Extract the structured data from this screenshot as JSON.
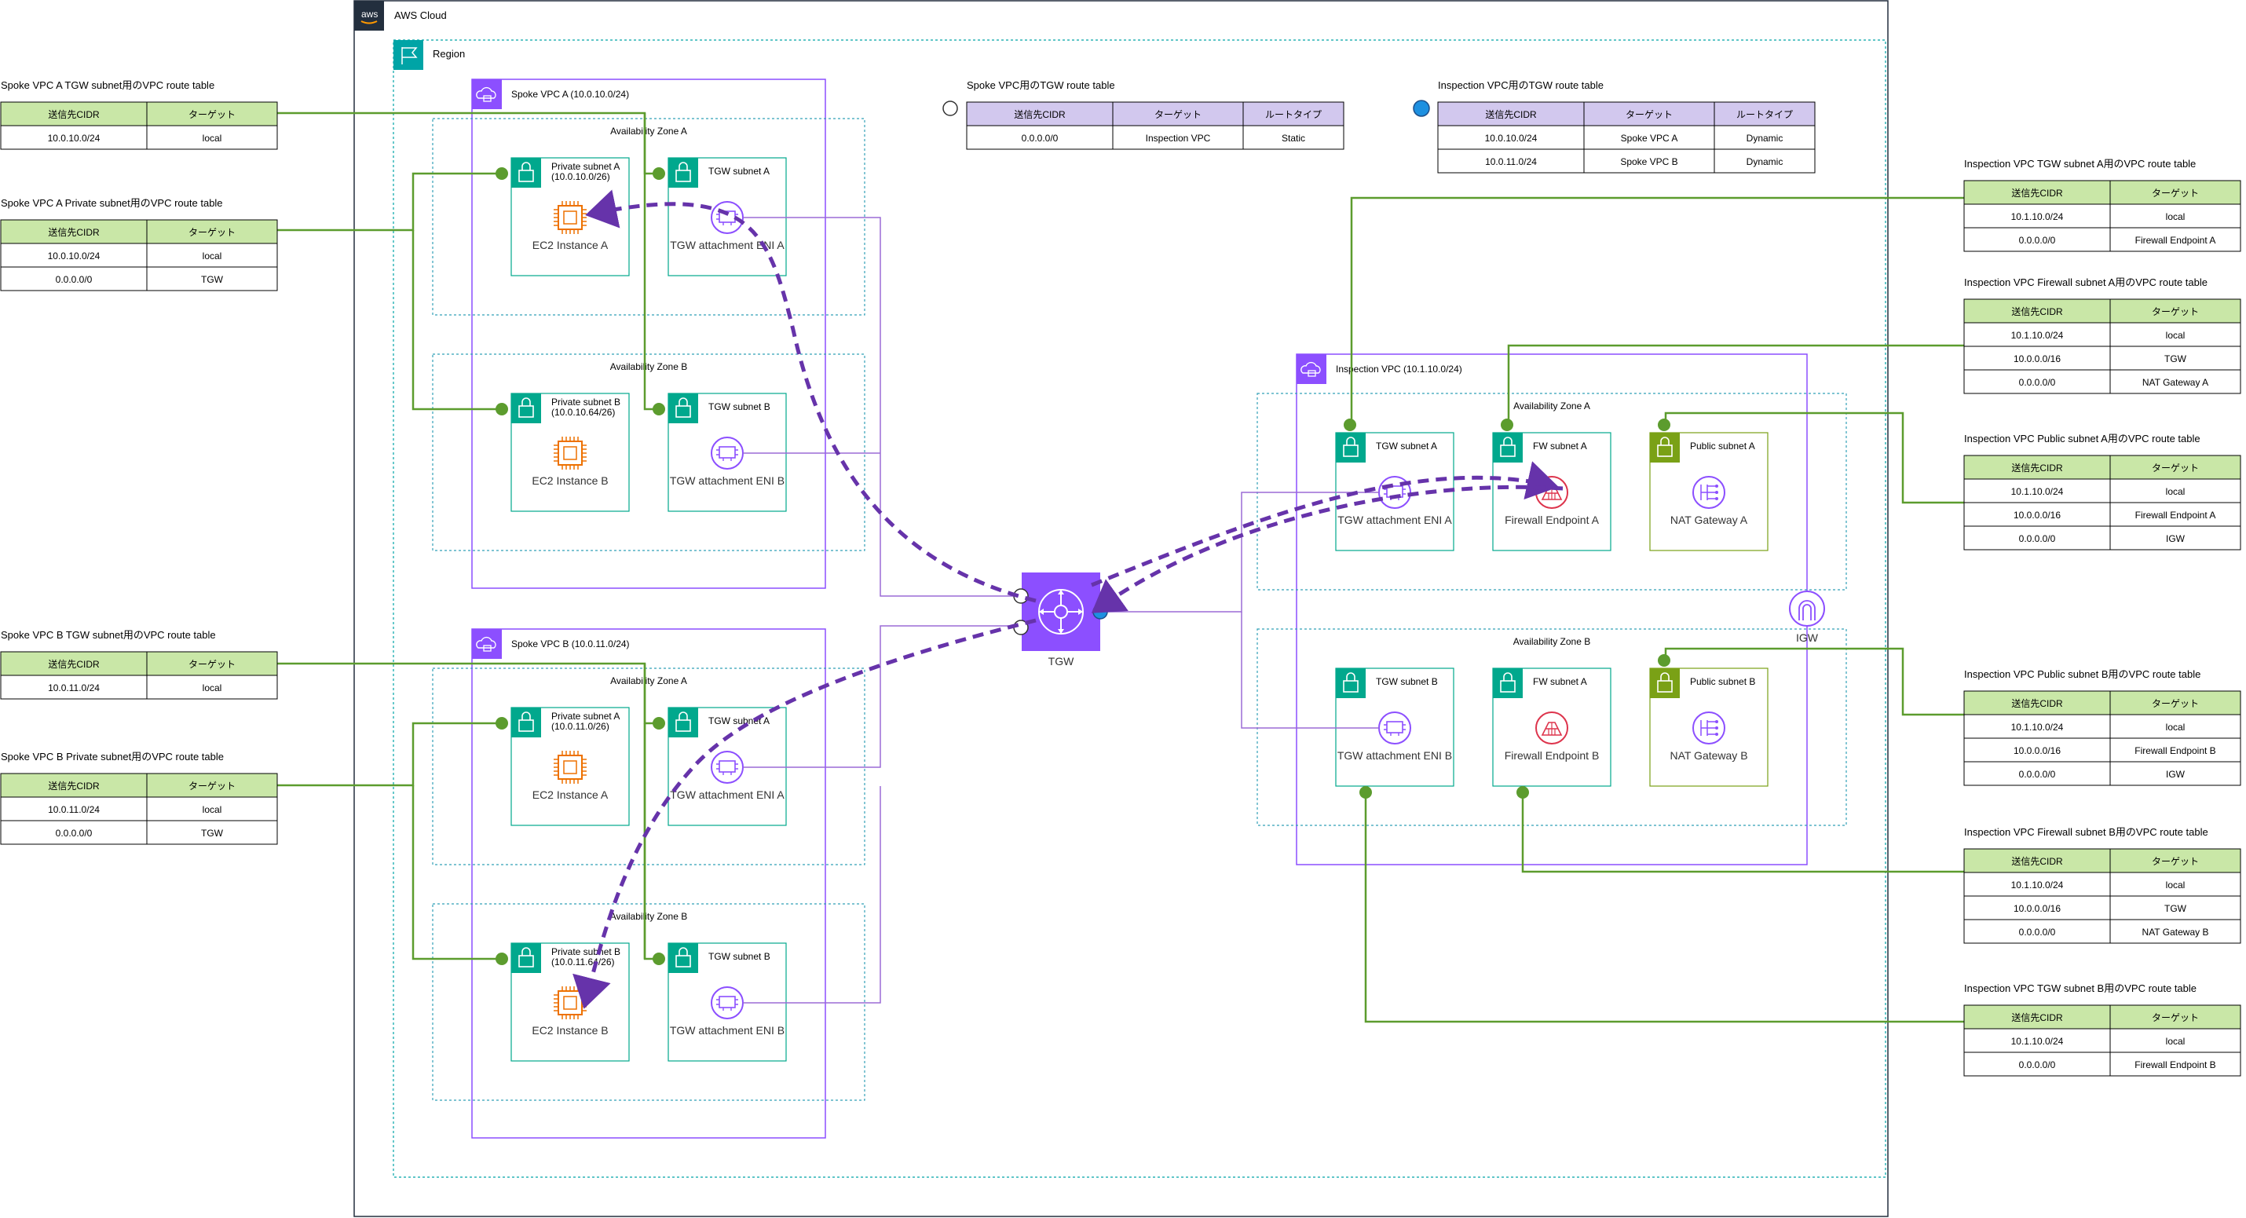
{
  "aws_cloud": {
    "label": "AWS Cloud",
    "icon": "aws-logo-icon"
  },
  "region": {
    "label": "Region",
    "icon": "region-flag-icon"
  },
  "tgw": {
    "label": "TGW"
  },
  "igw": {
    "label": "IGW"
  },
  "colors": {
    "route_line": "#5c9c2e",
    "tgw_purple": "#8c4fff",
    "attachment_line": "#9b6bd6",
    "traffic_path": "#6633aa",
    "subnet_teal": "#01a88d",
    "public_green": "#7aa116",
    "ec2_orange": "#ed7100",
    "firewall_red": "#dd344c",
    "vpc_border": "#8c4fff",
    "az_border": "#32a0b8",
    "table_header_green": "#c9e7a7",
    "table_header_lavender": "#d2c8ee"
  },
  "spoke_vpc_a": {
    "label": "Spoke VPC A (10.0.10.0/24)",
    "az_a": "Availability Zone A",
    "az_b": "Availability Zone B",
    "private_a": {
      "title": "Private subnet A",
      "cidr": "(10.0.10.0/26)",
      "resource": "EC2 Instance A"
    },
    "tgw_a": {
      "title": "TGW subnet A",
      "resource": "TGW attachment ENI A"
    },
    "private_b": {
      "title": "Private subnet B",
      "cidr": "(10.0.10.64/26)",
      "resource": "EC2 Instance B"
    },
    "tgw_b": {
      "title": "TGW subnet B",
      "resource": "TGW attachment ENI B"
    }
  },
  "spoke_vpc_b": {
    "label": "Spoke VPC B (10.0.11.0/24)",
    "az_a": "Availability Zone A",
    "az_b": "Availability Zone B",
    "private_a": {
      "title": "Private subnet A",
      "cidr": "(10.0.11.0/26)",
      "resource": "EC2 Instance A"
    },
    "tgw_a": {
      "title": "TGW subnet A",
      "resource": "TGW attachment ENI A"
    },
    "private_b": {
      "title": "Private subnet B",
      "cidr": "(10.0.11.64/26)",
      "resource": "EC2 Instance B"
    },
    "tgw_b": {
      "title": "TGW subnet B",
      "resource": "TGW attachment ENI B"
    }
  },
  "inspection_vpc": {
    "label": "Inspection VPC (10.1.10.0/24)",
    "az_a": "Availability Zone A",
    "az_b": "Availability Zone B",
    "tgw_a": {
      "title": "TGW subnet A",
      "resource": "TGW attachment ENI A"
    },
    "fw_a": {
      "title": "FW subnet A",
      "resource": "Firewall Endpoint A"
    },
    "pub_a": {
      "title": "Public subnet A",
      "resource": "NAT Gateway A"
    },
    "tgw_b": {
      "title": "TGW subnet B",
      "resource": "TGW attachment ENI B"
    },
    "fw_b": {
      "title": "FW subnet A",
      "resource": "Firewall Endpoint B"
    },
    "pub_b": {
      "title": "Public subnet B",
      "resource": "NAT Gateway B"
    }
  },
  "tables": {
    "spoke_a_tgw": {
      "title": "Spoke VPC A TGW subnet用のVPC route table",
      "headers": [
        "送信先CIDR",
        "ターゲット"
      ],
      "rows": [
        [
          "10.0.10.0/24",
          "local"
        ]
      ]
    },
    "spoke_a_private": {
      "title": "Spoke VPC A Private subnet用のVPC route table",
      "headers": [
        "送信先CIDR",
        "ターゲット"
      ],
      "rows": [
        [
          "10.0.10.0/24",
          "local"
        ],
        [
          "0.0.0.0/0",
          "TGW"
        ]
      ]
    },
    "spoke_b_tgw": {
      "title": "Spoke VPC B TGW subnet用のVPC route table",
      "headers": [
        "送信先CIDR",
        "ターゲット"
      ],
      "rows": [
        [
          "10.0.11.0/24",
          "local"
        ]
      ]
    },
    "spoke_b_private": {
      "title": "Spoke VPC B Private subnet用のVPC route table",
      "headers": [
        "送信先CIDR",
        "ターゲット"
      ],
      "rows": [
        [
          "10.0.11.0/24",
          "local"
        ],
        [
          "0.0.0.0/0",
          "TGW"
        ]
      ]
    },
    "spoke_tgw_rt": {
      "title": "Spoke VPC用のTGW route table",
      "headers": [
        "送信先CIDR",
        "ターゲット",
        "ルートタイプ"
      ],
      "rows": [
        [
          "0.0.0.0/0",
          "Inspection VPC",
          "Static"
        ]
      ]
    },
    "inspection_tgw_rt": {
      "title": "Inspection VPC用のTGW route table",
      "headers": [
        "送信先CIDR",
        "ターゲット",
        "ルートタイプ"
      ],
      "rows": [
        [
          "10.0.10.0/24",
          "Spoke VPC A",
          "Dynamic"
        ],
        [
          "10.0.11.0/24",
          "Spoke VPC B",
          "Dynamic"
        ]
      ]
    },
    "insp_tgw_a": {
      "title": "Inspection VPC TGW subnet A用のVPC route table",
      "headers": [
        "送信先CIDR",
        "ターゲット"
      ],
      "rows": [
        [
          "10.1.10.0/24",
          "local"
        ],
        [
          "0.0.0.0/0",
          "Firewall Endpoint A"
        ]
      ]
    },
    "insp_fw_a": {
      "title": "Inspection VPC Firewall subnet A用のVPC route table",
      "headers": [
        "送信先CIDR",
        "ターゲット"
      ],
      "rows": [
        [
          "10.1.10.0/24",
          "local"
        ],
        [
          "10.0.0.0/16",
          "TGW"
        ],
        [
          "0.0.0.0/0",
          "NAT Gateway A"
        ]
      ]
    },
    "insp_pub_a": {
      "title": "Inspection VPC Public subnet A用のVPC route table",
      "headers": [
        "送信先CIDR",
        "ターゲット"
      ],
      "rows": [
        [
          "10.1.10.0/24",
          "local"
        ],
        [
          "10.0.0.0/16",
          "Firewall Endpoint A"
        ],
        [
          "0.0.0.0/0",
          "IGW"
        ]
      ]
    },
    "insp_pub_b": {
      "title": "Inspection VPC Public subnet B用のVPC route table",
      "headers": [
        "送信先CIDR",
        "ターゲット"
      ],
      "rows": [
        [
          "10.1.10.0/24",
          "local"
        ],
        [
          "10.0.0.0/16",
          "Firewall Endpoint B"
        ],
        [
          "0.0.0.0/0",
          "IGW"
        ]
      ]
    },
    "insp_fw_b": {
      "title": "Inspection VPC Firewall subnet B用のVPC route table",
      "headers": [
        "送信先CIDR",
        "ターゲット"
      ],
      "rows": [
        [
          "10.1.10.0/24",
          "local"
        ],
        [
          "10.0.0.0/16",
          "TGW"
        ],
        [
          "0.0.0.0/0",
          "NAT Gateway B"
        ]
      ]
    },
    "insp_tgw_b": {
      "title": "Inspection VPC TGW subnet B用のVPC route table",
      "headers": [
        "送信先CIDR",
        "ターゲット"
      ],
      "rows": [
        [
          "10.1.10.0/24",
          "local"
        ],
        [
          "0.0.0.0/0",
          "Firewall Endpoint B"
        ]
      ]
    }
  }
}
